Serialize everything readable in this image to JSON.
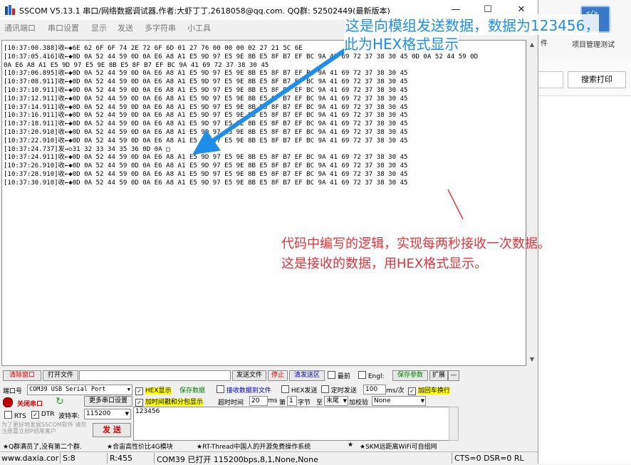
{
  "window": {
    "title": "SSCOM V5.13.1 串口/网络数据调试器,作者:大虾丁丁,2618058@qq.com. QQ群: 52502449(最新版本)",
    "minimize": "—",
    "maximize": "☐",
    "close": "✕"
  },
  "menu": [
    "通讯端口",
    "串口设置",
    "显示",
    "发送",
    "多字符串",
    "小工具"
  ],
  "receive_lines": [
    "[10:37:00.388]收←◆6E 62 6F 6F 74 2E 72 6F 6D 01 27 76 00 00 00 02 27 21 5C 6E",
    "[10:37:05.416]收←◆0D 0A 52 44 59 0D 0A E6 A8 A1 E5 9D 97 E5 9E 8B E5 8F B7 EF BC 9A 41 69 72 37 38 30 45 0D 0A 52 44 59 0D",
    "0A E6 A8 A1 E5 9D 97 E5 9E 8B E5 8F B7 EF BC 9A 41 69 72 37 38 30 45",
    "[10:37:06.895]收←◆0D 0A 52 44 59 0D 0A E6 A8 A1 E5 9D 97 E5 9E 8B E5 8F B7 EF BC 9A 41 69 72 37 38 30 45",
    "[10:37:08.911]收←◆0D 0A 52 44 59 0D 0A E6 A8 A1 E5 9D 97 E5 9E 8B E5 8F B7 EF BC 9A 41 69 72 37 38 30 45",
    "[10:37:10.911]收←◆0D 0A 52 44 59 0D 0A E6 A8 A1 E5 9D 97 E5 9E 8B E5 8F B7 EF BC 9A 41 69 72 37 38 30 45",
    "[10:37:12.911]收←◆0D 0A 52 44 59 0D 0A E6 A8 A1 E5 9D 97 E5 9E 8B E5 8F B7 EF BC 9A 41 69 72 37 38 30 45",
    "[10:37:14.911]收←◆0D 0A 52 44 59 0D 0A E6 A8 A1 E5 9D 97 E5 9E 8B E5 8F B7 EF BC 9A 41 69 72 37 38 30 45",
    "[10:37:16.911]收←◆0D 0A 52 44 59 0D 0A E6 A8 A1 E5 9D 97 E5 9E 8B E5 8F B7 EF BC 9A 41 69 72 37 38 30 45",
    "[10:37:18.911]收←◆0D 0A 52 44 59 0D 0A E6 A8 A1 E5 9D 97 E5 9E 8B E5 8F B7 EF BC 9A 41 69 72 37 38 30 45",
    "[10:37:20.910]收←◆0D 0A 52 44 59 0D 0A E6 A8 A1 E5 9D 97 E5 9E 8B E5 8F B7 EF BC 9A 41 69 72 37 38 30 45",
    "[10:37:22.910]收←◆0D 0A 52 44 59 0D 0A E6 A8 A1 E5 9D 97 E5 9E 8B E5 8F B7 EF BC 9A 41 69 72 37 38 30 45",
    "[10:37:24.737]发→◇31 32 33 34 35 36 0D 0A □",
    "[10:37:24.911]收←◆0D 0A 52 44 59 0D 0A E6 A8 A1 E5 9D 97 E5 9E 8B E5 8F B7 EF BC 9A 41 69 72 37 38 30 45",
    "[10:37:26.910]收←◆0D 0A 52 44 59 0D 0A E6 A8 A1 E5 9D 97 E5 9E 8B E5 8F B7 EF BC 9A 41 69 72 37 38 30 45",
    "[10:37:28.910]收←◆0D 0A 52 44 59 0D 0A E6 A8 A1 E5 9D 97 E5 9E 8B E5 8F B7 EF BC 9A 41 69 72 37 38 30 45",
    "[10:37:30.910]收←◆0D 0A 52 44 59 0D 0A E6 A8 A1 E5 9D 97 E5 9E 8B E5 8F B7 EF BC 9A 41 69 72 37 38 30 45"
  ],
  "controls": {
    "clear_window": "清除窗口",
    "open_file": "打开文件",
    "send_file": "发送文件",
    "stop": "停止",
    "clear_send_area": "清发送区",
    "topmost": "最前",
    "english": "Engl:",
    "save_params": "保存参数",
    "expand": "扩展",
    "dash": "—",
    "port_label": "端口号",
    "port_value": "COM39 USB Serial Port",
    "hex_display": "HEX显示",
    "save_data": "保存数据",
    "recv_to_file": "接收数据到文件",
    "hex_send": "HEX发送",
    "timed_send": "定时发送",
    "period_value": "100",
    "period_unit": "ms/次",
    "add_crlf": "加回车换行",
    "close_port": "关闭串口",
    "more_port_settings": "更多串口设置",
    "timestamp_label": "加时间戳和分包显示",
    "timeout_label": "超时时间",
    "timeout_value": "20",
    "timeout_unit": "ms",
    "byte_index_prefix": "第",
    "byte_index_value": "1",
    "byte_index_unit": "字节",
    "to_label": "至",
    "tail_value": "末尾",
    "checksum_label": "加校验",
    "checksum_value": "None",
    "rts": "RTS",
    "dtr": "DTR",
    "baud_label": "波特率:",
    "baud_value": "115200",
    "send_text": "123456",
    "send_button": "发 送",
    "promo": "为了更好地发展SSCOM软件 请您注册嘉立创P结尾客户"
  },
  "ticker": [
    "★Q群满员了,没有第二个群.",
    "★合宙高性价比4G模块",
    "★RT-Thread中国人的开源免费操作系统",
    "★",
    "★SKM远距离WiFi可自组网"
  ],
  "status": {
    "site": "www.daxia.cor",
    "s": "S:8",
    "r": "R:455",
    "port": "COM39 已打开  115200bps,8,1,None,None",
    "lines": "CTS=0 DSR=0 RL"
  },
  "background_app": {
    "project_icon_text": "</>",
    "project_label": "项目管理测试",
    "partial_label": "件",
    "search_print": "搜索打印"
  },
  "annotations": {
    "top_line1": "这是向模组发送数据，数据为123456，",
    "top_line2": "此为HEX格式显示",
    "bottom_line1": "代码中编写的逻辑，实现每两秒接收一次数据。",
    "bottom_line2": "这是接收的数据，用HEX格式显示。"
  },
  "colors": {
    "annotation_blue": "#1e8ee8",
    "annotation_red": "#e0343f",
    "hex_highlight": "#ffff00"
  }
}
